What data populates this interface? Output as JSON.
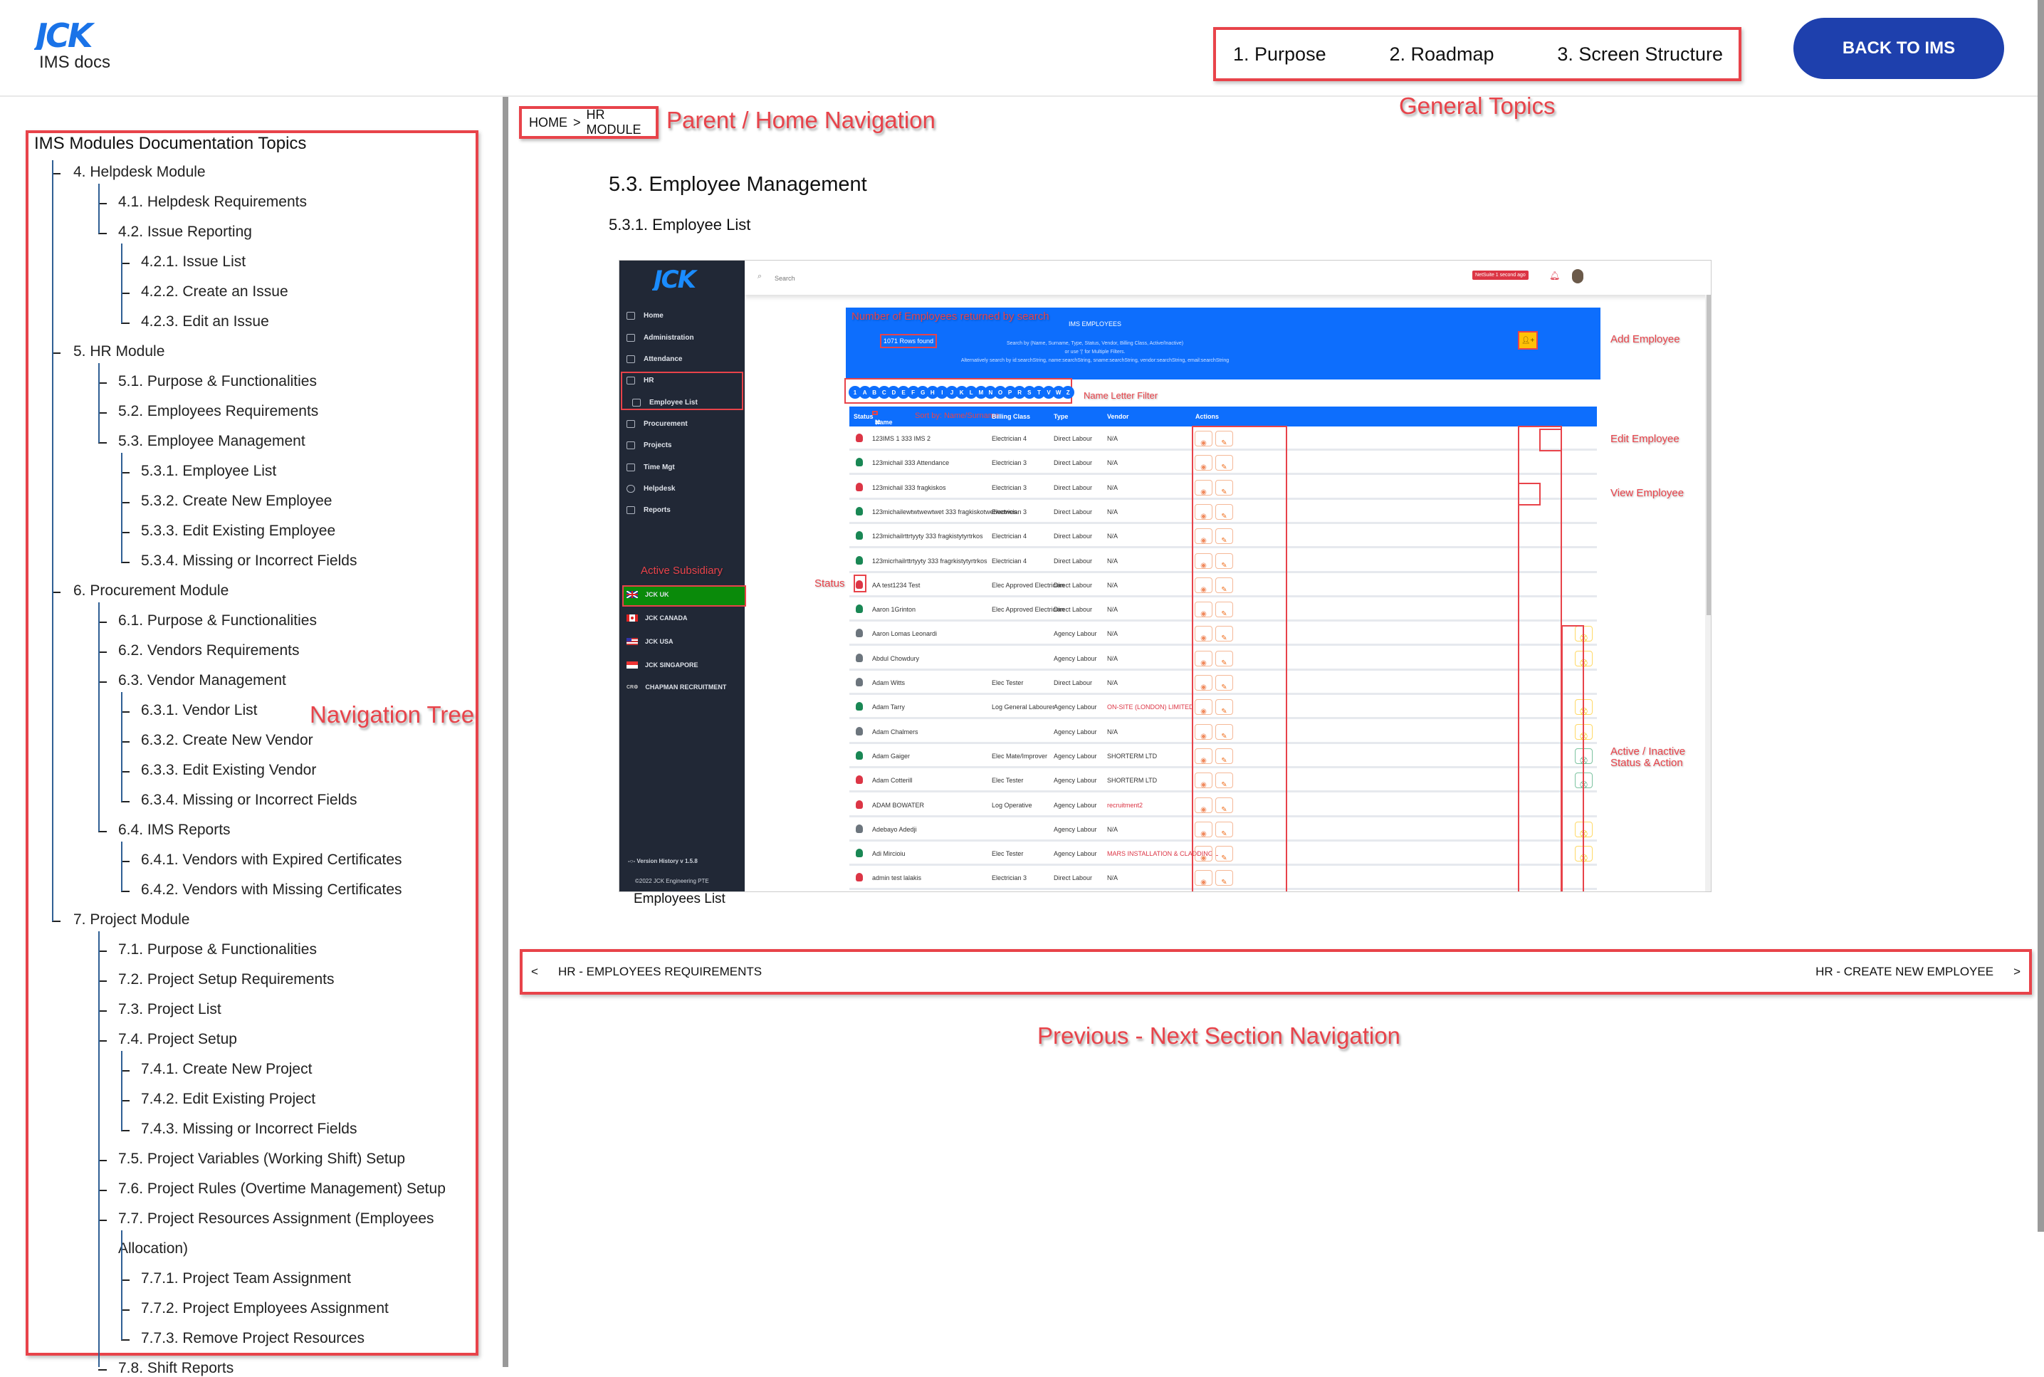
{
  "header": {
    "logo_text": "JCK",
    "subtitle": "IMS docs",
    "general_topics": [
      "1. Purpose",
      "2. Roadmap",
      "3. Screen Structure"
    ],
    "back_button": "BACK TO IMS",
    "brand_color": "#1e40ad",
    "logo_color": "#1a73e8"
  },
  "annotations": {
    "general_topics": "General Topics",
    "parent_home": "Parent / Home Navigation",
    "navigation_tree": "Navigation Tree",
    "prev_next": "Previous - Next Section Navigation",
    "rows_found": "Number of Employees returned by search",
    "add_employee": "Add Employee",
    "name_letter_filter": "Name Letter Filter",
    "sort_by": "Sort by: Name/Surname",
    "edit_employee": "Edit Employee",
    "view_employee": "View Employee",
    "status": "Status",
    "active_subsidiary": "Active Subsidiary",
    "active_inactive_1": "Active / Inactive",
    "active_inactive_2": "Status & Action",
    "annotation_color": "#e8434a"
  },
  "nav_tree": {
    "title": "IMS Modules Documentation Topics",
    "items": [
      {
        "label": "4. Helpdesk Module",
        "level": 1
      },
      {
        "label": "4.1. Helpdesk Requirements",
        "level": 2
      },
      {
        "label": "4.2. Issue Reporting",
        "level": 2
      },
      {
        "label": "4.2.1. Issue List",
        "level": 3
      },
      {
        "label": "4.2.2. Create an Issue",
        "level": 3
      },
      {
        "label": "4.2.3. Edit an Issue",
        "level": 3
      },
      {
        "label": "5. HR Module",
        "level": 1
      },
      {
        "label": "5.1. Purpose & Functionalities",
        "level": 2
      },
      {
        "label": "5.2. Employees Requirements",
        "level": 2
      },
      {
        "label": "5.3. Employee Management",
        "level": 2
      },
      {
        "label": "5.3.1. Employee List",
        "level": 3
      },
      {
        "label": "5.3.2. Create New Employee",
        "level": 3
      },
      {
        "label": "5.3.3. Edit Existing Employee",
        "level": 3
      },
      {
        "label": "5.3.4. Missing or Incorrect Fields",
        "level": 3
      },
      {
        "label": "6. Procurement Module",
        "level": 1
      },
      {
        "label": "6.1. Purpose & Functionalities",
        "level": 2
      },
      {
        "label": "6.2. Vendors Requirements",
        "level": 2
      },
      {
        "label": "6.3. Vendor Management",
        "level": 2
      },
      {
        "label": "6.3.1. Vendor List",
        "level": 3
      },
      {
        "label": "6.3.2. Create New Vendor",
        "level": 3
      },
      {
        "label": "6.3.3. Edit Existing Vendor",
        "level": 3
      },
      {
        "label": "6.3.4. Missing or Incorrect Fields",
        "level": 3
      },
      {
        "label": "6.4. IMS Reports",
        "level": 2
      },
      {
        "label": "6.4.1. Vendors with Expired Certificates",
        "level": 3
      },
      {
        "label": "6.4.2. Vendors with Missing Certificates",
        "level": 3
      },
      {
        "label": "7. Project Module",
        "level": 1
      },
      {
        "label": "7.1. Purpose & Functionalities",
        "level": 2
      },
      {
        "label": "7.2. Project Setup Requirements",
        "level": 2
      },
      {
        "label": "7.3. Project List",
        "level": 2
      },
      {
        "label": "7.4. Project Setup",
        "level": 2
      },
      {
        "label": "7.4.1. Create New Project",
        "level": 3
      },
      {
        "label": "7.4.2. Edit Existing Project",
        "level": 3
      },
      {
        "label": "7.4.3. Missing or Incorrect Fields",
        "level": 3
      },
      {
        "label": "7.5. Project Variables (Working Shift) Setup",
        "level": 2
      },
      {
        "label": "7.6. Project Rules (Overtime Management) Setup",
        "level": 2
      },
      {
        "label": "7.7. Project Resources Assignment (Employees",
        "level": 2
      },
      {
        "label": "Allocation)",
        "level": 2,
        "continuation": true
      },
      {
        "label": "7.7.1. Project Team Assignment",
        "level": 3
      },
      {
        "label": "7.7.2. Project Employees Assignment",
        "level": 3
      },
      {
        "label": "7.7.3. Remove Project Resources",
        "level": 3
      },
      {
        "label": "7.8. Shift Reports",
        "level": 2
      }
    ]
  },
  "breadcrumb": {
    "home": "HOME",
    "separator": ">",
    "current": "HR MODULE"
  },
  "content": {
    "section_title": "5.3. Employee Management",
    "subsection_title": "5.3.1. Employee List",
    "figure_caption": "Employees List"
  },
  "app_screenshot": {
    "logo": "JCK",
    "search_placeholder": "Search",
    "netsuite_badge": "NetSuite 1 second ago",
    "sidebar": [
      "Home",
      "Administration",
      "Attendance",
      "HR",
      "Employee List",
      "Procurement",
      "Projects",
      "Time Mgt",
      "Helpdesk",
      "Reports"
    ],
    "subsidiaries": [
      {
        "label": "JCK UK",
        "active": true
      },
      {
        "label": "JCK CANADA",
        "active": false
      },
      {
        "label": "JCK USA",
        "active": false
      },
      {
        "label": "JCK SINGAPORE",
        "active": false
      },
      {
        "label": "CHAPMAN RECRUITMENT",
        "active": false
      }
    ],
    "version": "Version History v 1.5.8",
    "copyright": "©2022 JCK Engineering PTE",
    "panel_title": "IMS EMPLOYEES",
    "rows_found": "1071 Rows found",
    "search_help_1": "Search by (Name, Surname, Type, Status, Vendor, Billing Class, Active/Inactive)",
    "search_help_2": "or use '|' for Multiple Filters.",
    "search_help_3": "Alternatively search by id:searchString, name:searchString, sname:searchString, vendor:searchString, email:searchString",
    "letters": [
      "1",
      "A",
      "B",
      "C",
      "D",
      "E",
      "F",
      "G",
      "H",
      "I",
      "J",
      "K",
      "L",
      "M",
      "N",
      "O",
      "P",
      "R",
      "S",
      "T",
      "V",
      "W",
      "Z"
    ],
    "columns": [
      "Status",
      "Name",
      "Billing Class",
      "Type",
      "Vendor",
      "Actions"
    ],
    "rows": [
      {
        "status": "red",
        "name": "123IMS 1 333 IMS 2",
        "billing": "Electrician 4",
        "type": "Direct Labour",
        "vendor": "N/A",
        "vendor_red": false,
        "toggle": ""
      },
      {
        "status": "green",
        "name": "123michail 333 Attendance",
        "billing": "Electrician 3",
        "type": "Direct Labour",
        "vendor": "N/A",
        "vendor_red": false,
        "toggle": ""
      },
      {
        "status": "red",
        "name": "123michail 333 fragkiskos",
        "billing": "Electrician 3",
        "type": "Direct Labour",
        "vendor": "N/A",
        "vendor_red": false,
        "toggle": ""
      },
      {
        "status": "green",
        "name": "123michailewtwtwewtwet 333 fragkiskotwetwetwes",
        "billing": "Electrician 3",
        "type": "Direct Labour",
        "vendor": "N/A",
        "vendor_red": false,
        "toggle": ""
      },
      {
        "status": "green",
        "name": "123michailrttrtyyty 333 fragkistytyrtrkos",
        "billing": "Electrician 4",
        "type": "Direct Labour",
        "vendor": "N/A",
        "vendor_red": false,
        "toggle": ""
      },
      {
        "status": "green",
        "name": "123micrhailrttrtyyty 333 fragrkistytyrtrkos",
        "billing": "Electrician 4",
        "type": "Direct Labour",
        "vendor": "N/A",
        "vendor_red": false,
        "toggle": ""
      },
      {
        "status": "red",
        "name": "AA test1234 Test",
        "billing": "Elec Approved Electrician",
        "type": "Direct Labour",
        "vendor": "N/A",
        "vendor_red": false,
        "toggle": ""
      },
      {
        "status": "green",
        "name": "Aaron 1Grinton",
        "billing": "Elec Approved Electrician",
        "type": "Direct Labour",
        "vendor": "N/A",
        "vendor_red": false,
        "toggle": ""
      },
      {
        "status": "grey",
        "name": "Aaron Lomas Leonardi",
        "billing": "",
        "type": "Agency Labour",
        "vendor": "N/A",
        "vendor_red": false,
        "toggle": "yellow"
      },
      {
        "status": "grey",
        "name": "Abdul Chowdury",
        "billing": "",
        "type": "Agency Labour",
        "vendor": "N/A",
        "vendor_red": false,
        "toggle": "yellow"
      },
      {
        "status": "grey",
        "name": "Adam Witts",
        "billing": "Elec Tester",
        "type": "Direct Labour",
        "vendor": "N/A",
        "vendor_red": false,
        "toggle": ""
      },
      {
        "status": "green",
        "name": "Adam Tarry",
        "billing": "Log General Labourer",
        "type": "Agency Labour",
        "vendor": "ON-SITE (LONDON) LIMITED",
        "vendor_red": true,
        "toggle": "yellow"
      },
      {
        "status": "grey",
        "name": "Adam Chalmers",
        "billing": "",
        "type": "Agency Labour",
        "vendor": "N/A",
        "vendor_red": false,
        "toggle": "yellow"
      },
      {
        "status": "green",
        "name": "Adam Gaiger",
        "billing": "Elec Mate/Improver",
        "type": "Agency Labour",
        "vendor": "SHORTERM LTD",
        "vendor_red": false,
        "toggle": "green"
      },
      {
        "status": "red",
        "name": "Adam Cotterill",
        "billing": "Elec Tester",
        "type": "Agency Labour",
        "vendor": "SHORTERM LTD",
        "vendor_red": false,
        "toggle": "green"
      },
      {
        "status": "red",
        "name": "ADAM BOWATER",
        "billing": "Log Operative",
        "type": "Agency Labour",
        "vendor": "recruitment2",
        "vendor_red": true,
        "toggle": ""
      },
      {
        "status": "grey",
        "name": "Adebayo Adedji",
        "billing": "",
        "type": "Agency Labour",
        "vendor": "N/A",
        "vendor_red": false,
        "toggle": "yellow"
      },
      {
        "status": "green",
        "name": "Adi Mircioiu",
        "billing": "Elec Tester",
        "type": "Agency Labour",
        "vendor": "MARS INSTALLATION & CLADDING L",
        "vendor_red": true,
        "toggle": "yellow"
      },
      {
        "status": "red",
        "name": "admin test lalakis",
        "billing": "Electrician 3",
        "type": "Direct Labour",
        "vendor": "N/A",
        "vendor_red": false,
        "toggle": ""
      }
    ],
    "status_colors": {
      "red": "#dc3545",
      "green": "#198754",
      "grey": "#6c757d"
    }
  },
  "prev_next": {
    "prev_label": "HR - EMPLOYEES REQUIREMENTS",
    "next_label": "HR - CREATE NEW EMPLOYEE",
    "prev_icon": "<",
    "next_icon": ">"
  }
}
